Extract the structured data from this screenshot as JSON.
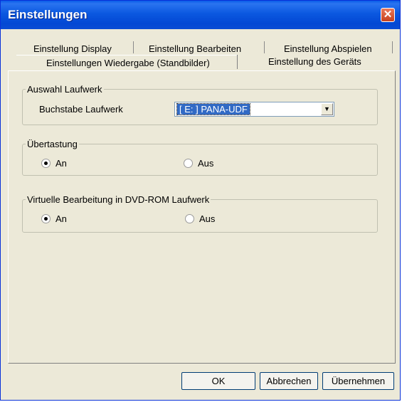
{
  "window": {
    "title": "Einstellungen"
  },
  "tabs_back": [
    "Einstellung Display",
    "Einstellung Bearbeiten",
    "Einstellung Abspielen"
  ],
  "tabs_front": [
    "Einstellungen Wiedergabe (Standbilder)",
    "Einstellung des Geräts"
  ],
  "drive_group": {
    "legend": "Auswahl Laufwerk",
    "label": "Buchstabe Laufwerk",
    "selected": "[ E: ] PANA-UDF"
  },
  "overkey_group": {
    "legend": "Übertastung",
    "on": "An",
    "off": "Aus",
    "state": "An"
  },
  "virtual_group": {
    "legend": "Virtuelle Bearbeitung in DVD-ROM Laufwerk",
    "on": "An",
    "off": "Aus",
    "state": "An"
  },
  "buttons": {
    "ok": "OK",
    "cancel": "Abbrechen",
    "apply": "Übernehmen"
  },
  "icons": {
    "close": "close-icon",
    "dropdown": "chevron-down-icon"
  },
  "colors": {
    "titlebar": "#0348d4",
    "dialog_bg": "#ece9d8",
    "close": "#c6411e",
    "selection": "#316ac5"
  }
}
